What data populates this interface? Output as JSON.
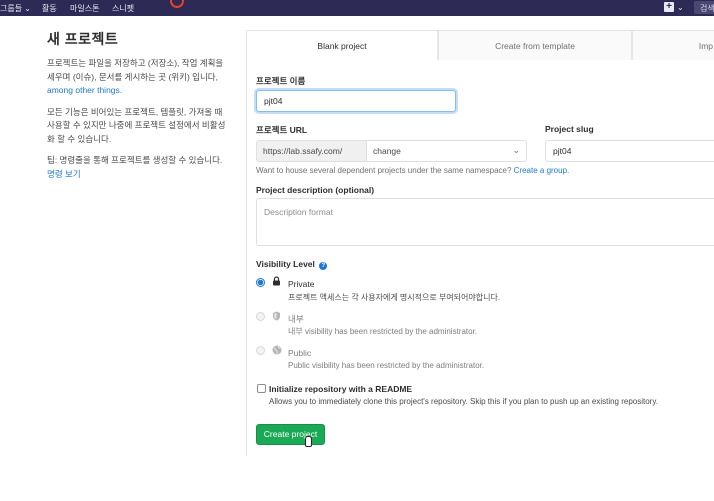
{
  "topnav": {
    "items": [
      "그룹들 ⌄",
      "활동",
      "마일스톤",
      "스니펫"
    ],
    "plus_label": "+",
    "plus_chevron": "⌄",
    "search_label": "검색"
  },
  "sidebar": {
    "title": "새 프로젝트",
    "desc1_text": "프로젝트는 파일을 저장하고 (저장소), 작업 계획을 세우며 (이슈), 문서를 게시하는 곳 (위키) 입니다,",
    "desc1_link": "among other things.",
    "desc2": "모든 기능은 비어있는 프로젝트, 템플릿, 가져올 때 사용할 수 있지만 나중에 프로젝트 설정에서 비활성화 할 수 있습니다.",
    "tip_text": "팁: 명령줄을 통해 프로젝트를 생성할 수 있습니다.",
    "tip_link": "명령 보기"
  },
  "tabs": [
    "Blank project",
    "Create from template",
    "Imp"
  ],
  "form": {
    "name_label": "프로젝트 이름",
    "name_value": "pjt04",
    "url_label": "프로젝트 URL",
    "url_prefix": "https://lab.ssafy.com/",
    "namespace_value": "change",
    "slug_label": "Project slug",
    "slug_value": "pjt04",
    "group_help_text": "Want to house several dependent projects under the same namespace?",
    "group_help_link": "Create a group.",
    "desc_label": "Project description (optional)",
    "desc_placeholder": "Description format",
    "visibility_label": "Visibility Level",
    "visibility_help_icon": "?",
    "visibility": [
      {
        "title": "Private",
        "desc": "프로젝트 액세스는 각 사용자에게 명시적으로 부여되어야합니다.",
        "icon": "lock-icon",
        "checked": true,
        "disabled": false
      },
      {
        "title": "내부",
        "desc": "내부 visibility has been restricted by the administrator.",
        "icon": "shield-icon",
        "checked": false,
        "disabled": true
      },
      {
        "title": "Public",
        "desc": "Public visibility has been restricted by the administrator.",
        "icon": "globe-icon",
        "checked": false,
        "disabled": true
      }
    ],
    "readme_label": "Initialize repository with a README",
    "readme_desc": "Allows you to immediately clone this project's repository. Skip this if you plan to push up an existing repository.",
    "submit_label": "Create project"
  },
  "colors": {
    "nav_bg": "#2d2b55",
    "primary_button": "#1aaa55",
    "link": "#1f78d1"
  }
}
